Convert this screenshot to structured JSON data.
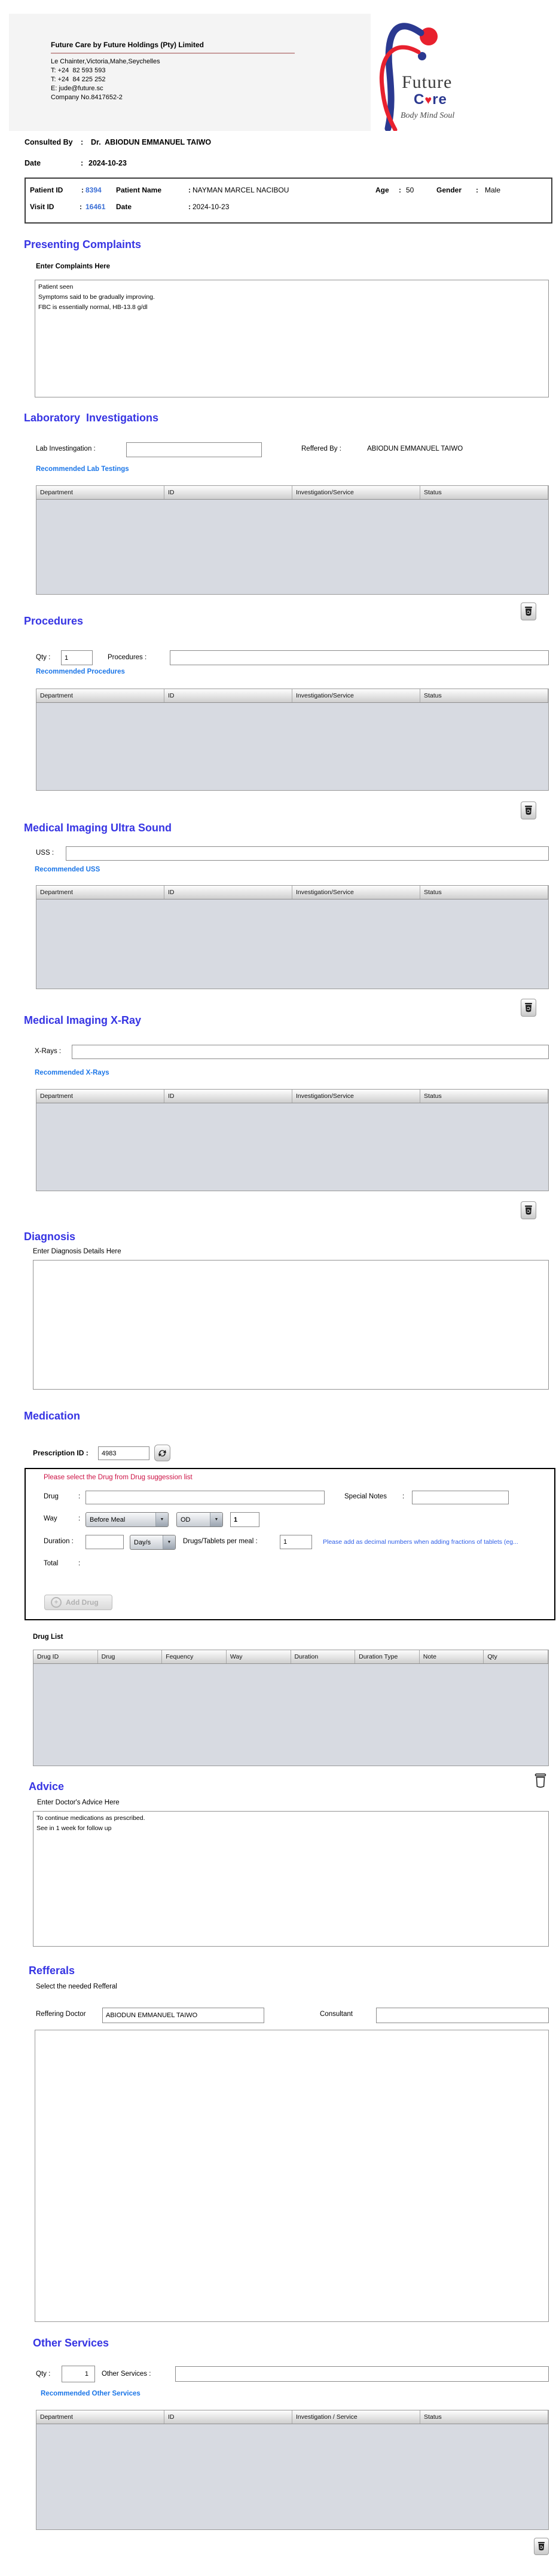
{
  "ui": {
    "colon": ":",
    "arrow": "▼",
    "plus": "+",
    "heart": "♥"
  },
  "header": {
    "company_name": "Future Care by Future Holdings (Pty) Limited",
    "address_lines": [
      "Le Chainter,Victoria,Mahe,Seychelles",
      "T: +24  82 593 593",
      "T: +24  84 225 252",
      "E: jude@future.sc",
      "Company No.8417652-2"
    ],
    "logo": {
      "word1": "Future",
      "care_c": "C",
      "care_re": "re",
      "tagline": "Body Mind Soul"
    }
  },
  "consult": {
    "consulted_by_label": "Consulted By",
    "consulted_by_value": "Dr.  ABIODUN EMMANUEL TAIWO",
    "date_label": "Date",
    "date_value": "2024-10-23"
  },
  "patient": {
    "patient_id_label": "Patient ID",
    "patient_id": "8394",
    "patient_name_label": "Patient Name",
    "patient_name": "NAYMAN MARCEL NACIBOU",
    "age_label": "Age",
    "age": "50",
    "gender_label": "Gender",
    "gender": "Male",
    "visit_id_label": "Visit ID",
    "visit_id": "16461",
    "visit_date_label": "Date",
    "visit_date": "2024-10-23"
  },
  "complaints": {
    "title": "Presenting Complaints",
    "hint": "Enter Complaints Here",
    "text": "Patient seen\nSymptoms said to be gradually improving.\nFBC is essentially normal, HB-13.8 g/dl"
  },
  "lab": {
    "title": "Laboratory  Investigations",
    "input_label": "Lab Investingation :",
    "input_value": "",
    "referred_by_label": "Reffered By :",
    "referred_by_value": "ABIODUN EMMANUEL TAIWO",
    "link": "Recommended Lab Testings"
  },
  "procedures": {
    "title": "Procedures",
    "qty_label": "Qty :",
    "qty_value": "1",
    "input_label": "Procedures :",
    "input_value": "",
    "link": "Recommended Procedures"
  },
  "uss": {
    "title": "Medical Imaging Ultra Sound",
    "input_label": "USS :",
    "input_value": "",
    "link": "Recommended USS"
  },
  "xray": {
    "title": "Medical Imaging X-Ray",
    "input_label": "X-Rays :",
    "input_value": "",
    "link": "Recommended X-Rays"
  },
  "diagnosis": {
    "title": "Diagnosis",
    "hint": "Enter Diagnosis Details Here",
    "text": ""
  },
  "medication": {
    "title": "Medication",
    "prescription_id_label": "Prescription ID :",
    "prescription_id": "4983",
    "warning": "Please select the Drug from Drug suggession list",
    "drug_label": "Drug",
    "drug_value": "",
    "special_notes_label": "Special Notes",
    "special_notes_value": "",
    "way_label": "Way",
    "way_value": "Before Meal",
    "frequency_value": "OD",
    "times_value": "1",
    "duration_label": "Duration :",
    "duration_value": "",
    "duration_unit": "Day/s",
    "per_meal_label": "Drugs/Tablets per meal :",
    "per_meal_value": "1",
    "note": "Please add as decimal numbers when adding fractions of tablets (eg...",
    "total_label": "Total",
    "add_drug_label": "Add Drug",
    "drug_list_label": "Drug List"
  },
  "advice": {
    "title": "Advice",
    "hint": "Enter Doctor's Advice Here",
    "text": "To continue medications as prescribed.\nSee in 1 week for follow up"
  },
  "referrals": {
    "title": "Refferals",
    "hint": "Select the needed Refferal",
    "doctor_label": "Reffering Doctor",
    "doctor_value": "ABIODUN EMMANUEL TAIWO",
    "consultant_label": "Consultant",
    "consultant_value": ""
  },
  "other_services": {
    "title": "Other Services",
    "qty_label": "Qty :",
    "qty_value": "1",
    "input_label": "Other Services :",
    "input_value": "",
    "link": "Recommended Other Services"
  },
  "table_headers": {
    "standard": [
      "Department",
      "ID",
      "Investigation/Service",
      "Status"
    ],
    "other": [
      "Department",
      "ID",
      "Investigation / Service",
      "Status"
    ],
    "drugs": [
      "Drug ID",
      "Drug",
      "Fequency",
      "Way",
      "Duration",
      "Duration Type",
      "Note",
      "Qty"
    ]
  }
}
